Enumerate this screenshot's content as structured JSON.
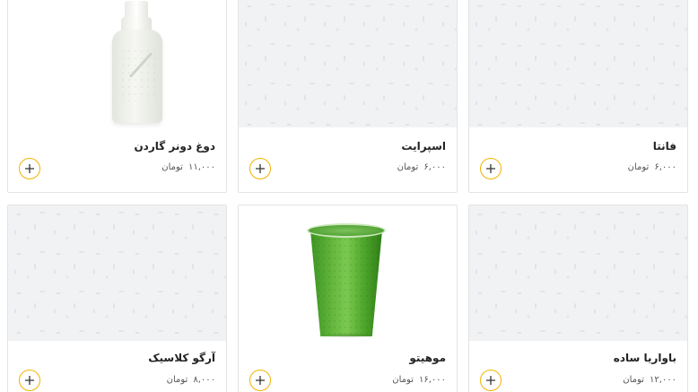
{
  "products": [
    {
      "title": "فانتا",
      "price": "۶,۰۰۰",
      "currency": "تومان",
      "image": "placeholder-pattern",
      "add_icon": "plus-icon"
    },
    {
      "title": "اسپرایت",
      "price": "۶,۰۰۰",
      "currency": "تومان",
      "image": "placeholder-pattern",
      "add_icon": "plus-icon"
    },
    {
      "title": "دوغ دونر گاردن",
      "price": "۱۱,۰۰۰",
      "currency": "تومان",
      "image": "dough-bottle",
      "add_icon": "plus-icon"
    },
    {
      "title": "باواریا ساده",
      "price": "۱۲,۰۰۰",
      "currency": "تومان",
      "image": "placeholder-pattern",
      "add_icon": "plus-icon"
    },
    {
      "title": "موهیتو",
      "price": "۱۶,۰۰۰",
      "currency": "تومان",
      "image": "green-mojito-cup",
      "add_icon": "plus-icon"
    },
    {
      "title": "آرگو کلاسیک",
      "price": "۸,۰۰۰",
      "currency": "تومان",
      "image": "placeholder-pattern",
      "add_icon": "plus-icon"
    }
  ],
  "colors": {
    "accent": "#f2b200",
    "card_border": "#e3e3e3",
    "placeholder_bg": "#f1f2f4",
    "title_text": "#222222",
    "price_text": "#555555"
  }
}
